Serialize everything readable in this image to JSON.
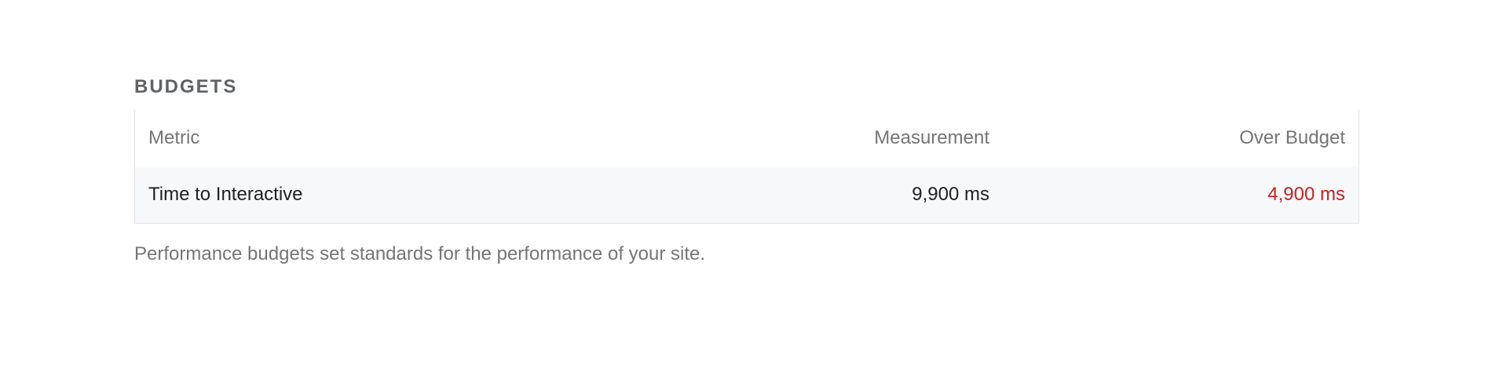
{
  "budgets": {
    "title": "BUDGETS",
    "table": {
      "headers": {
        "metric": "Metric",
        "measurement": "Measurement",
        "over_budget": "Over Budget"
      },
      "rows": [
        {
          "metric": "Time to Interactive",
          "measurement": "9,900 ms",
          "over_budget": "4,900 ms"
        }
      ]
    },
    "description": "Performance budgets set standards for the performance of your site."
  },
  "colors": {
    "over_budget": "#c5221f",
    "row_background": "#f7f8fa"
  }
}
